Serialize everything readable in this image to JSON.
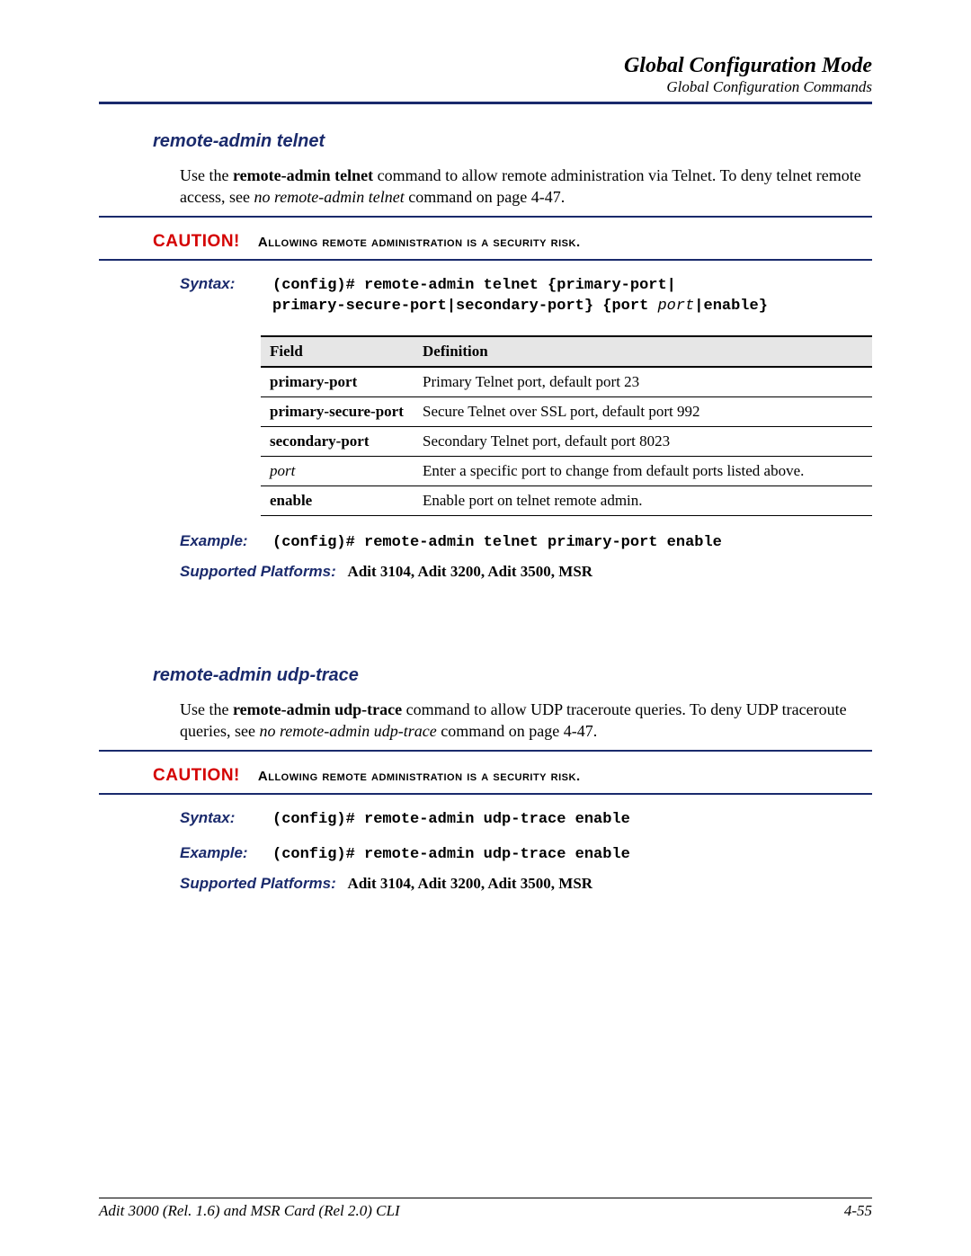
{
  "header": {
    "title": "Global Configuration Mode",
    "subtitle": "Global Configuration Commands"
  },
  "sections": [
    {
      "title": "remote-admin telnet",
      "intro_pre": "Use the ",
      "intro_cmd": "remote-admin telnet",
      "intro_post": " command to allow remote administration via Telnet. To deny telnet remote access, see ",
      "intro_ref": "no remote-admin telnet",
      "intro_tail": " command on page 4-47.",
      "caution_label": "CAUTION!",
      "caution_text": "Allowing remote administration is a security risk.",
      "syntax_label": "Syntax:",
      "syntax_code_1": "(config)# remote-admin telnet {primary-port|",
      "syntax_code_2a": "primary-secure-port|secondary-port} {port ",
      "syntax_code_2b": "port",
      "syntax_code_2c": "|enable}",
      "table": {
        "h1": "Field",
        "h2": "Definition",
        "rows": [
          {
            "f": "primary-port",
            "d": "Primary Telnet port, default port 23",
            "italic": false
          },
          {
            "f": "primary-secure-port",
            "d": "Secure Telnet over SSL port, default port 992",
            "italic": false
          },
          {
            "f": "secondary-port",
            "d": "Secondary Telnet port, default port 8023",
            "italic": false
          },
          {
            "f": "port",
            "d": "Enter a specific port to change from default ports listed above.",
            "italic": true
          },
          {
            "f": "enable",
            "d": "Enable port on telnet remote admin.",
            "italic": false
          }
        ]
      },
      "example_label": "Example:",
      "example_code": "(config)# remote-admin telnet primary-port enable",
      "platforms_label": "Supported Platforms:",
      "platforms_value": "Adit 3104, Adit 3200, Adit 3500, MSR"
    },
    {
      "title": "remote-admin udp-trace",
      "intro_pre": "Use the ",
      "intro_cmd": "remote-admin udp-trace",
      "intro_post": " command to allow UDP traceroute queries. To deny UDP traceroute queries, see ",
      "intro_ref": "no remote-admin udp-trace",
      "intro_tail": " command on page 4-47.",
      "caution_label": "CAUTION!",
      "caution_text": "Allowing remote administration is a security risk.",
      "syntax_label": "Syntax:",
      "syntax_code": "(config)# remote-admin udp-trace enable",
      "example_label": "Example:",
      "example_code": "(config)# remote-admin udp-trace enable",
      "platforms_label": "Supported Platforms:",
      "platforms_value": "Adit 3104, Adit 3200, Adit 3500, MSR"
    }
  ],
  "footer": {
    "left": "Adit 3000 (Rel. 1.6) and MSR Card (Rel 2.0) CLI",
    "right": "4-55"
  }
}
